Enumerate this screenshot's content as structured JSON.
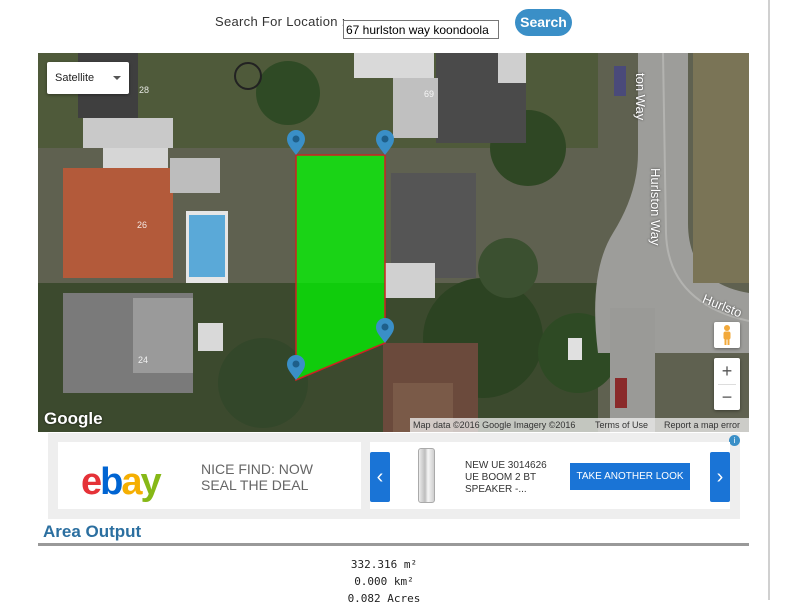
{
  "search": {
    "label": "Search For Location :",
    "value": "67 hurlston way koondoola",
    "button": "Search"
  },
  "map": {
    "type_selector": "Satellite",
    "streets": [
      "ton Way",
      "Hurlston Way",
      "Hurlsto"
    ],
    "house_numbers": [
      "26",
      "24",
      "28",
      "69"
    ],
    "logo": "Google",
    "attribution": {
      "data": "Map data ©2016 Google Imagery ©2016",
      "terms": "Terms of Use",
      "report": "Report a map error"
    },
    "zoom_in": "+",
    "zoom_out": "−",
    "polygon_color": "#00ff00",
    "marker_color": "#3a8fc7"
  },
  "ad": {
    "info": "i",
    "ebay_letters": [
      "e",
      "b",
      "a",
      "y"
    ],
    "tagline_1": "NICE FIND: NOW",
    "tagline_2": "SEAL THE DEAL",
    "prev": "‹",
    "next": "›",
    "product_1": "NEW UE 3014626",
    "product_2": "UE BOOM 2 BT",
    "product_3": "SPEAKER -...",
    "cta": "TAKE ANOTHER LOOK"
  },
  "area": {
    "title": "Area Output",
    "values": [
      "332.316 m²",
      "0.000 km²",
      "0.082 Acres"
    ]
  }
}
